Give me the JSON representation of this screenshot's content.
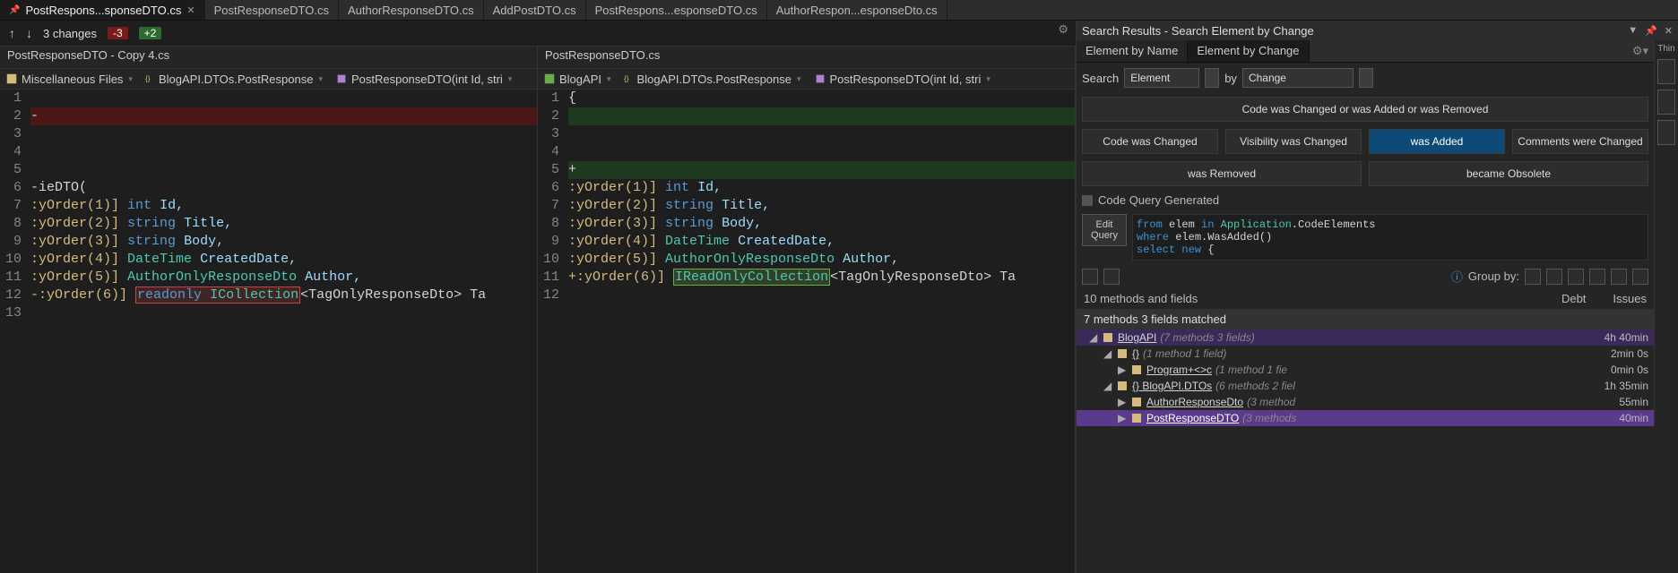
{
  "tabs": [
    {
      "label": "PostRespons...sponseDTO.cs",
      "active": true,
      "pinned": true,
      "closable": true
    },
    {
      "label": "PostResponseDTO.cs"
    },
    {
      "label": "AuthorResponseDTO.cs"
    },
    {
      "label": "AddPostDTO.cs"
    },
    {
      "label": "PostRespons...esponseDTO.cs"
    },
    {
      "label": "AuthorRespon...esponseDto.cs"
    }
  ],
  "changebar": {
    "count": "3 changes",
    "minus": "-3",
    "plus": "+2"
  },
  "left": {
    "title": "PostResponseDTO - Copy 4.cs",
    "crumbs": [
      "Miscellaneous Files",
      "BlogAPI.DTOs.PostResponse",
      "PostResponseDTO(int Id, stri"
    ],
    "gutter": [
      "1",
      "2",
      "3",
      "4",
      "5",
      "6",
      "7",
      "8",
      "9",
      "10",
      "11",
      "12",
      "13"
    ],
    "lines": {
      "l2": "-",
      "l6": "-ieDTO(",
      "l7_pre": ":yOrder(1)] ",
      "l7_kw": "int",
      "l7_post": " Id,",
      "l8_pre": ":yOrder(2)] ",
      "l8_kw": "string",
      "l8_post": " Title,",
      "l9_pre": ":yOrder(3)] ",
      "l9_kw": "string",
      "l9_post": " Body,",
      "l10_pre": ":yOrder(4)] ",
      "l10_t": "DateTime",
      "l10_post": " CreatedDate,",
      "l11_pre": ":yOrder(5)] ",
      "l11_t": "AuthorOnlyResponseDto",
      "l11_post": " Author,",
      "l12_pre": "-:yOrder(6)] ",
      "l12_box": "readonly ICollection",
      "l12_post": "<TagOnlyResponseDto> Ta"
    }
  },
  "right": {
    "title": "PostResponseDTO.cs",
    "crumbs": [
      "BlogAPI",
      "BlogAPI.DTOs.PostResponse",
      "PostResponseDTO(int Id, stri"
    ],
    "gutter": [
      "1",
      "2",
      "3",
      "4",
      "5",
      "6",
      "7",
      "8",
      "9",
      "10",
      "11",
      "12"
    ],
    "lines": {
      "l5": "+",
      "l6_pre": ":yOrder(1)] ",
      "l6_kw": "int",
      "l6_post": " Id,",
      "l7_pre": ":yOrder(2)] ",
      "l7_kw": "string",
      "l7_post": " Title,",
      "l8_pre": ":yOrder(3)] ",
      "l8_kw": "string",
      "l8_post": " Body,",
      "l9_pre": ":yOrder(4)] ",
      "l9_t": "DateTime",
      "l9_post": " CreatedDate,",
      "l10_pre": ":yOrder(5)] ",
      "l10_t": "AuthorOnlyResponseDto",
      "l10_post": " Author,",
      "l11_pre": "+:yOrder(6)] ",
      "l11_box": "IReadOnlyCollection",
      "l11_post": "<TagOnlyResponseDto> Ta"
    }
  },
  "panel": {
    "title": "Search Results - Search Element by Change",
    "modeTabs": [
      "Element by Name",
      "Element by Change"
    ],
    "searchLabel": "Search",
    "searchVal": "Element",
    "byLabel": "by",
    "byVal": "Change",
    "buttons": [
      {
        "t": "Code was Changed or was Added or was Removed",
        "wide": true
      },
      {
        "t": "Code was Changed"
      },
      {
        "t": "Visibility was Changed"
      },
      {
        "t": "was Added",
        "active": true
      },
      {
        "t": "Comments were Changed"
      },
      {
        "t": "was Removed"
      },
      {
        "t": "became Obsolete"
      }
    ],
    "cqTitle": "Code Query Generated",
    "editQuery": "Edit Query",
    "cqCode": "from elem in Application.CodeElements\nwhere elem.WasAdded()\nselect new {",
    "groupBy": "Group by:",
    "countRow": {
      "left": "10 methods and fields",
      "debt": "Debt",
      "issues": "Issues"
    },
    "treeHead": "7 methods   3 fields   matched",
    "tree": [
      {
        "ind": 0,
        "arw": "◢",
        "ico": "asm",
        "label": "BlogAPI",
        "meta": "(7 methods   3 fields)",
        "time": "4h  40min",
        "sel": "sel2"
      },
      {
        "ind": 1,
        "arw": "◢",
        "ico": "ns",
        "label": "{}",
        "meta": "(1 method   1 field)",
        "time": "2min  0s"
      },
      {
        "ind": 2,
        "arw": "▶",
        "ico": "cls",
        "label": "Program+<>c",
        "meta": "(1 method   1 fie",
        "time": "0min  0s"
      },
      {
        "ind": 1,
        "arw": "◢",
        "ico": "ns",
        "label": "{}  BlogAPI.DTOs",
        "meta": "(6 methods   2 fiel",
        "time": "1h  35min"
      },
      {
        "ind": 2,
        "arw": "▶",
        "ico": "cls",
        "label": "AuthorResponseDto",
        "meta": "(3 method",
        "time": "55min"
      },
      {
        "ind": 2,
        "arw": "▶",
        "ico": "cls",
        "label": "PostResponseDTO",
        "meta": "(3 methods",
        "time": "40min",
        "sel": "sel"
      }
    ],
    "thin": "Thin"
  }
}
